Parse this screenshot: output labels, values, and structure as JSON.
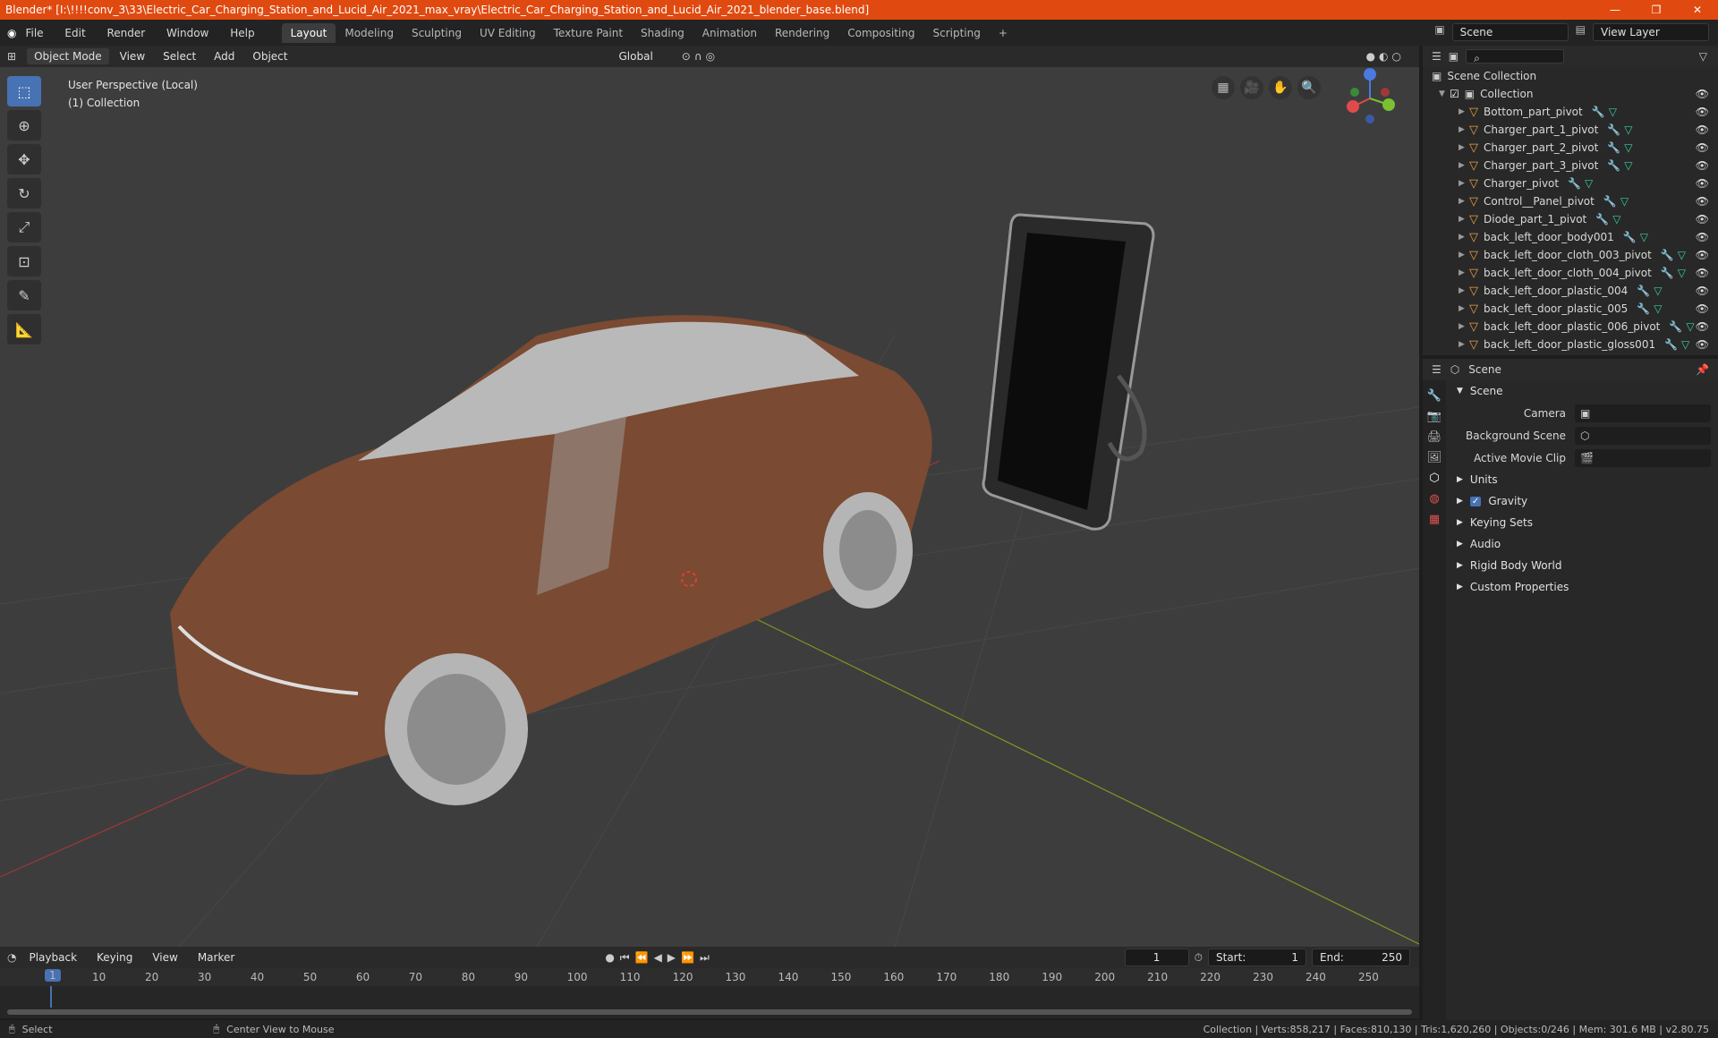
{
  "window": {
    "title": "Blender* [I:\\!!!!conv_3\\33\\Electric_Car_Charging_Station_and_Lucid_Air_2021_max_vray\\Electric_Car_Charging_Station_and_Lucid_Air_2021_blender_base.blend]",
    "min": "—",
    "max": "❐",
    "close": "✕"
  },
  "menu": [
    "File",
    "Edit",
    "Render",
    "Window",
    "Help"
  ],
  "workspaces": [
    "Layout",
    "Modeling",
    "Sculpting",
    "UV Editing",
    "Texture Paint",
    "Shading",
    "Animation",
    "Rendering",
    "Compositing",
    "Scripting"
  ],
  "scene": "Scene",
  "view_layer": "View Layer",
  "viewport_header": {
    "mode": "Object Mode",
    "view": "View",
    "select": "Select",
    "add": "Add",
    "object": "Object",
    "orientation": "Global"
  },
  "viewport": {
    "perspective": "User Perspective (Local)",
    "collection": "(1) Collection"
  },
  "outliner": {
    "root": "Scene Collection",
    "collection": "Collection",
    "items": [
      "Bottom_part_pivot",
      "Charger_part_1_pivot",
      "Charger_part_2_pivot",
      "Charger_part_3_pivot",
      "Charger_pivot",
      "Control__Panel_pivot",
      "Diode_part_1_pivot",
      "back_left_door_body001",
      "back_left_door_cloth_003_pivot",
      "back_left_door_cloth_004_pivot",
      "back_left_door_plastic_004",
      "back_left_door_plastic_005",
      "back_left_door_plastic_006_pivot",
      "back_left_door_plastic_gloss001"
    ]
  },
  "properties": {
    "context": "Scene",
    "panel": "Scene",
    "camera_label": "Camera",
    "bg_label": "Background Scene",
    "clip_label": "Active Movie Clip",
    "sections": [
      "Units",
      "Gravity",
      "Keying Sets",
      "Audio",
      "Rigid Body World",
      "Custom Properties"
    ]
  },
  "timeline": {
    "playback": "Playback",
    "keying": "Keying",
    "view": "View",
    "marker": "Marker",
    "frame": "1",
    "start_label": "Start:",
    "start": "1",
    "end_label": "End:",
    "end": "250",
    "ticks": [
      "1",
      "10",
      "20",
      "30",
      "40",
      "50",
      "60",
      "70",
      "80",
      "90",
      "100",
      "110",
      "120",
      "130",
      "140",
      "150",
      "160",
      "170",
      "180",
      "190",
      "200",
      "210",
      "220",
      "230",
      "240",
      "250"
    ]
  },
  "status": {
    "left": "Select",
    "mid": "Center View to Mouse",
    "right": "Collection | Verts:858,217 | Faces:810,130 | Tris:1,620,260 | Objects:0/246 | Mem: 301.6 MB | v2.80.75"
  }
}
